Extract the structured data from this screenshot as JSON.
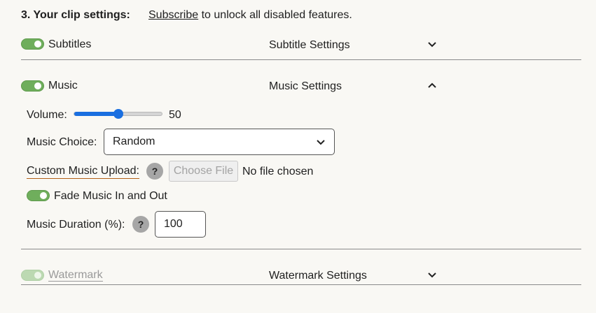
{
  "header": {
    "title": "3. Your clip settings:",
    "subscribe_link": "Subscribe",
    "message": " to unlock all disabled features."
  },
  "subtitles": {
    "label": "Subtitles",
    "settings_label": "Subtitle Settings",
    "enabled": true,
    "expanded": false
  },
  "music": {
    "label": "Music",
    "settings_label": "Music Settings",
    "enabled": true,
    "expanded": true,
    "volume_label": "Volume:",
    "volume_value": "50",
    "volume": 0.5,
    "choice_label": "Music Choice:",
    "choice_value": "Random",
    "upload_label": "Custom Music Upload:",
    "help_icon_text": "?",
    "choose_file_label": "Choose File",
    "no_file_text": "No file chosen",
    "fade_label": "Fade Music In and Out",
    "fade_enabled": true,
    "duration_label": "Music Duration (%):",
    "duration_value": "100"
  },
  "watermark": {
    "label": "Watermark",
    "settings_label": "Watermark Settings",
    "enabled": true,
    "disabled": true,
    "expanded": false
  },
  "colors": {
    "toggle_on": "#6fae5c",
    "accent": "#1a6fe0",
    "upload_underline": "#b35f16"
  }
}
